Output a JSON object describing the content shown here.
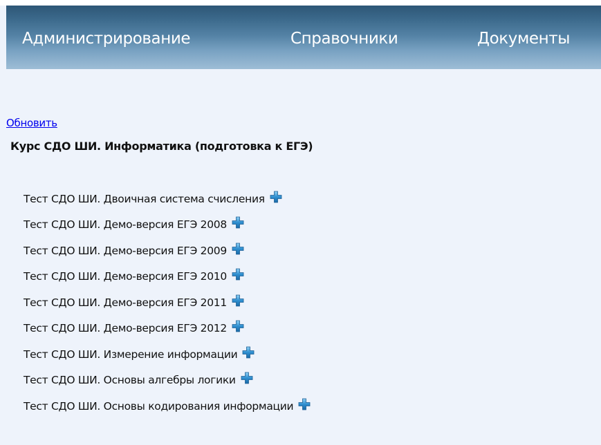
{
  "nav": {
    "items": [
      {
        "label": "Администрирование"
      },
      {
        "label": "Справочники"
      },
      {
        "label": "Документы"
      }
    ]
  },
  "refresh_label": "Обновить",
  "course": {
    "title": "Курс СДО ШИ. Информатика (подготовка к ЕГЭ)"
  },
  "tests": [
    {
      "label": "Тест СДО ШИ. Двоичная система счисления",
      "icon": "plus-icon"
    },
    {
      "label": "Тест СДО ШИ. Демо-версия ЕГЭ 2008",
      "icon": "plus-icon"
    },
    {
      "label": "Тест СДО ШИ. Демо-версия ЕГЭ 2009",
      "icon": "plus-icon"
    },
    {
      "label": "Тест СДО ШИ. Демо-версия ЕГЭ 2010",
      "icon": "plus-icon"
    },
    {
      "label": "Тест СДО ШИ. Демо-версия ЕГЭ 2011",
      "icon": "plus-icon"
    },
    {
      "label": "Тест СДО ШИ. Демо-версия ЕГЭ 2012",
      "icon": "plus-icon"
    },
    {
      "label": "Тест СДО ШИ. Измерение информации",
      "icon": "plus-icon"
    },
    {
      "label": "Тест СДО ШИ. Основы алгебры логики",
      "icon": "plus-icon"
    },
    {
      "label": "Тест СДО ШИ. Основы кодирования информации",
      "icon": "plus-icon"
    }
  ],
  "colors": {
    "link": "#0000ee",
    "page_background": "#eef3fb",
    "navbar_dark": "#2d5676",
    "navbar_light": "#9dbdd6",
    "icon_blue": "#2e86c1"
  }
}
